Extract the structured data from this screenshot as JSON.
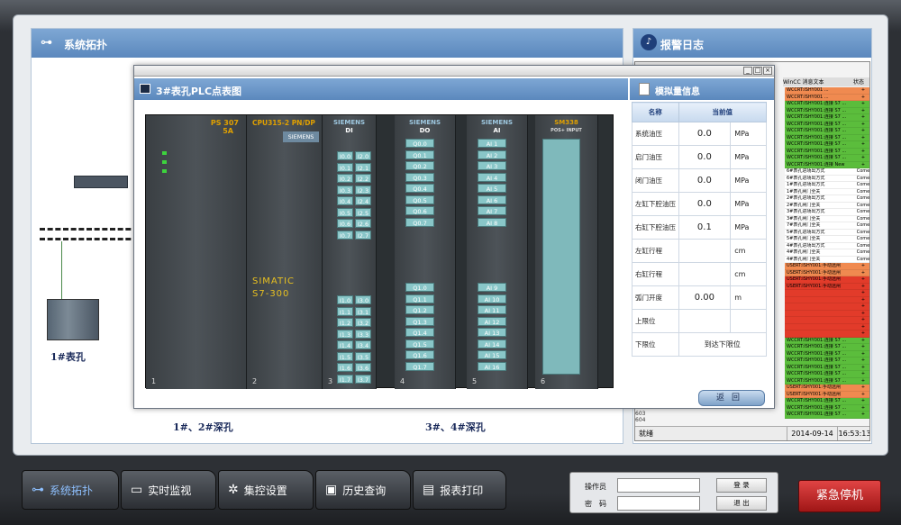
{
  "topology": {
    "title": "系统拓扑",
    "labels": {
      "table1": "1#表孔",
      "deep12": "1#、2#深孔",
      "deep34": "3#、4#深孔"
    }
  },
  "alarm_log": {
    "title": "报警日志",
    "columns": {
      "text": "WinCC 消息文本",
      "status": "状态"
    },
    "rows": [
      {
        "t": "WCCRT:ISHY001 ...",
        "s": "+",
        "c": "#f08a50"
      },
      {
        "t": "WCCRT:ISHY001 ...",
        "s": "+",
        "c": "#f08a50"
      },
      {
        "t": "WCCRT:ISHY001:连接 S7 ...",
        "s": "+",
        "c": "#5bbd3c"
      },
      {
        "t": "WCCRT:ISHY001:连接 S7 ...",
        "s": "+",
        "c": "#5bbd3c"
      },
      {
        "t": "WCCRT:ISHY001:连接 S7 ...",
        "s": "+",
        "c": "#5bbd3c"
      },
      {
        "t": "WCCRT:ISHY001:连接 S7 ...",
        "s": "+",
        "c": "#5bbd3c"
      },
      {
        "t": "WCCRT:ISHY001:连接 S7 ...",
        "s": "+",
        "c": "#5bbd3c"
      },
      {
        "t": "WCCRT:ISHY001:连接 S7 ...",
        "s": "+",
        "c": "#5bbd3c"
      },
      {
        "t": "WCCRT:ISHY001:连接 S7 ...",
        "s": "+",
        "c": "#5bbd3c"
      },
      {
        "t": "WCCRT:ISHY001:连接 S7 ...",
        "s": "+",
        "c": "#5bbd3c"
      },
      {
        "t": "WCCRT:ISHY001:连接 S7 ...",
        "s": "+",
        "c": "#5bbd3c"
      },
      {
        "t": "WCCRT:ISHY001:连接 New",
        "s": "+",
        "c": "#5bbd3c"
      },
      {
        "t": "6#表孔进场出方式",
        "s": "Come",
        "c": "#ffffff"
      },
      {
        "t": "6#表孔进场出方式",
        "s": "Come",
        "c": "#ffffff"
      },
      {
        "t": "1#表孔进场出方式",
        "s": "Come",
        "c": "#ffffff"
      },
      {
        "t": "1#表孔闸门全关",
        "s": "Come",
        "c": "#ffffff"
      },
      {
        "t": "2#表孔进场出方式",
        "s": "Come",
        "c": "#ffffff"
      },
      {
        "t": "2#表孔闸门全关",
        "s": "Come",
        "c": "#ffffff"
      },
      {
        "t": "3#表孔进场出方式",
        "s": "Come",
        "c": "#ffffff"
      },
      {
        "t": "3#表孔闸门全关",
        "s": "Come",
        "c": "#ffffff"
      },
      {
        "t": "7#表孔闸门全关",
        "s": "Come",
        "c": "#ffffff"
      },
      {
        "t": "5#表孔进场出方式",
        "s": "Come",
        "c": "#ffffff"
      },
      {
        "t": "5#表孔闸门全关",
        "s": "Come",
        "c": "#ffffff"
      },
      {
        "t": "4#表孔进场出方式",
        "s": "Come",
        "c": "#ffffff"
      },
      {
        "t": "4#表孔闸门全关",
        "s": "Come",
        "c": "#ffffff"
      },
      {
        "t": "4#表孔闸门全关",
        "s": "Come",
        "c": "#ffffff"
      },
      {
        "t": "USERT:ISHY001:手动远闸",
        "s": "+",
        "c": "#f08a50"
      },
      {
        "t": "USERT:ISHY001:手动远闸",
        "s": "+",
        "c": "#f08a50"
      },
      {
        "t": "USERT:ISHY001:手动远闸",
        "s": "+",
        "c": "#e23b2a"
      },
      {
        "t": "USERT:ISHY001:手动远闸",
        "s": "+",
        "c": "#e23b2a"
      },
      {
        "t": "",
        "s": "+",
        "c": "#e23b2a"
      },
      {
        "t": "",
        "s": "+",
        "c": "#e23b2a"
      },
      {
        "t": "",
        "s": "+",
        "c": "#e23b2a"
      },
      {
        "t": "",
        "s": "+",
        "c": "#e23b2a"
      },
      {
        "t": "",
        "s": "+",
        "c": "#e23b2a"
      },
      {
        "t": "",
        "s": "+",
        "c": "#e23b2a"
      },
      {
        "t": "",
        "s": "+",
        "c": "#e23b2a"
      },
      {
        "t": "WCCRT:ISHY001:连接 S7 ...",
        "s": "+",
        "c": "#5bbd3c"
      },
      {
        "t": "WCCRT:ISHY001:连接 S7 ...",
        "s": "+",
        "c": "#5bbd3c"
      },
      {
        "t": "WCCRT:ISHY001:连接 S7 ...",
        "s": "+",
        "c": "#5bbd3c"
      },
      {
        "t": "WCCRT:ISHY001:连接 S7 ...",
        "s": "+",
        "c": "#5bbd3c"
      },
      {
        "t": "WCCRT:ISHY001:连接 S7 ...",
        "s": "+",
        "c": "#5bbd3c"
      },
      {
        "t": "WCCRT:ISHY001:连接 S7 ...",
        "s": "+",
        "c": "#5bbd3c"
      },
      {
        "t": "WCCRT:ISHY001:连接 S7 ...",
        "s": "+",
        "c": "#5bbd3c"
      },
      {
        "t": "USERT:ISHY001:手动远闸",
        "s": "+",
        "c": "#f08a50"
      },
      {
        "t": "USERT:ISHY001:手动远闸",
        "s": "+",
        "c": "#f08a50"
      },
      {
        "t": "WCCRT:ISHY001:连接 S7 ...",
        "s": "+",
        "c": "#5bbd3c"
      },
      {
        "t": "WCCRT:ISHY001:连接 S7 ...",
        "s": "+",
        "c": "#5bbd3c"
      },
      {
        "t": "WCCRT:ISHY001:连接 S7 ...",
        "s": "+",
        "c": "#5bbd3c"
      }
    ],
    "side_rows": [
      "603",
      "604"
    ],
    "status": {
      "left": "就绪",
      "date": "2014-09-14",
      "time": "16:53:13"
    }
  },
  "popup": {
    "left_title": "3#表孔PLC点表图",
    "right_title": "模拟量信息",
    "rack": {
      "ps": {
        "name": "PS 307",
        "sub": "5A"
      },
      "cpu": {
        "name": "CPU315-2 PN/DP",
        "brand": "SIEMENS",
        "model1": "SIMATIC",
        "model2": "S7-300"
      },
      "modules": [
        {
          "name": "SIEMENS",
          "type": "DI"
        },
        {
          "name": "SIEMENS",
          "type": "DO"
        },
        {
          "name": "SIEMENS",
          "type": "AI"
        },
        {
          "name": "SM338",
          "type": "POS+ INPUT"
        }
      ],
      "di_labels": [
        "I0.0",
        "I2.0",
        "I0.1",
        "I2.1",
        "I0.2",
        "I2.2",
        "I0.3",
        "I2.3",
        "I0.4",
        "I2.4",
        "I0.5",
        "I2.5",
        "I0.6",
        "I2.6",
        "I0.7",
        "I2.7",
        "I1.0",
        "I3.0",
        "I1.1",
        "I3.1",
        "I1.2",
        "I3.2",
        "I1.3",
        "I3.3",
        "I1.4",
        "I3.4",
        "I1.5",
        "I3.5",
        "I1.6",
        "I3.6",
        "I1.7",
        "I3.7"
      ],
      "do_labels": [
        "Q0.0",
        "Q0.1",
        "Q0.2",
        "Q0.3",
        "Q0.4",
        "Q0.5",
        "Q0.6",
        "Q0.7",
        "Q1.0",
        "Q1.1",
        "Q1.2",
        "Q1.3",
        "Q1.4",
        "Q1.5",
        "Q1.6",
        "Q1.7"
      ],
      "ai_labels": [
        "AI 1",
        "AI 2",
        "AI 3",
        "AI 4",
        "AI 5",
        "AI 6",
        "AI 7",
        "AI 8",
        "AI 9",
        "AI 10",
        "AI 11",
        "AI 12",
        "AI 13",
        "AI 14",
        "AI 15",
        "AI 16"
      ],
      "slots": [
        "1",
        "2",
        "3",
        "4",
        "5",
        "6"
      ]
    },
    "table": {
      "headers": {
        "name": "名称",
        "value": "当前值"
      },
      "rows": [
        {
          "name": "系统油压",
          "value": "0.0",
          "unit": "MPa"
        },
        {
          "name": "启门油压",
          "value": "0.0",
          "unit": "MPa"
        },
        {
          "name": "闭门油压",
          "value": "0.0",
          "unit": "MPa"
        },
        {
          "name": "左缸下腔油压",
          "value": "0.0",
          "unit": "MPa"
        },
        {
          "name": "右缸下腔油压",
          "value": "0.1",
          "unit": "MPa"
        },
        {
          "name": "左缸行程",
          "value": "",
          "unit": "cm"
        },
        {
          "name": "右缸行程",
          "value": "",
          "unit": "cm"
        },
        {
          "name": "弧门开度",
          "value": "0.00",
          "unit": "m"
        },
        {
          "name": "上限位",
          "value": "",
          "unit": ""
        },
        {
          "name": "下限位",
          "value": "到达下限位",
          "unit": ""
        }
      ],
      "back_label": "返回"
    }
  },
  "nav": [
    {
      "label": "系统拓扑",
      "icon": "topology-icon",
      "glyph": "⊶",
      "active": true
    },
    {
      "label": "实时监视",
      "icon": "monitor-icon",
      "glyph": "▭"
    },
    {
      "label": "集控设置",
      "icon": "gear-icon",
      "glyph": "✲"
    },
    {
      "label": "历史查询",
      "icon": "history-icon",
      "glyph": "▣"
    },
    {
      "label": "报表打印",
      "icon": "report-icon",
      "glyph": "▤"
    }
  ],
  "login": {
    "operator": "操作员",
    "password": "密　码",
    "login_btn": "登 录",
    "logout_btn": "退 出"
  },
  "estop": "紧急停机"
}
